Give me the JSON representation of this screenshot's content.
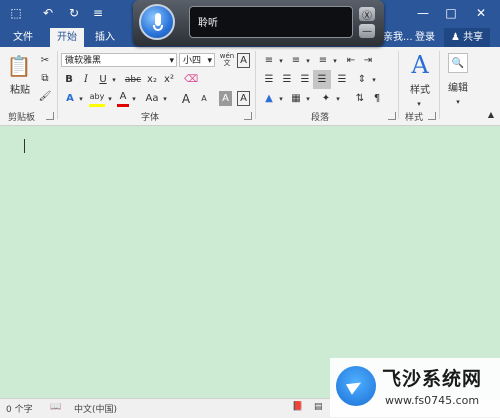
{
  "quick_access": {
    "save": "⬚",
    "undo": "↶",
    "redo": "↻",
    "more": "≡"
  },
  "window_controls": {
    "minimize": "—",
    "maximize": "□",
    "close": "✕"
  },
  "tabs": [
    {
      "label": "文件"
    },
    {
      "label": "开始"
    },
    {
      "label": "插入"
    },
    {
      "label": "亲我..."
    }
  ],
  "account": {
    "login": "登录",
    "share": "共享"
  },
  "voice_panel": {
    "text": "聆听",
    "close_glyph": "Ⓧ",
    "minimize_glyph": "—"
  },
  "clipboard": {
    "paste_label": "粘贴",
    "group_label": "剪贴板"
  },
  "font": {
    "name": "微软雅黑",
    "size": "小四",
    "bold": "B",
    "italic": "I",
    "underline": "U",
    "strike": "abc",
    "subscript": "x₂",
    "superscript": "x²",
    "font_color": "A",
    "highlight": "aby",
    "change_case": "Aa",
    "grow": "A",
    "shrink": "A",
    "char_border": "A",
    "char_shade": "A",
    "wen": "wén",
    "group_label": "字体"
  },
  "paragraph": {
    "group_label": "段落"
  },
  "styles": {
    "label": "样式",
    "group_label": "样式"
  },
  "editing": {
    "label": "编辑"
  },
  "status": {
    "word_count": "0 个字",
    "language": "中文(中国)"
  },
  "watermark": {
    "title": "飞沙系统网",
    "url": "www.fs0745.com"
  },
  "colors": {
    "accent": "#2b579a",
    "document": "#cdebd2",
    "font_color_bar": "#e00000",
    "highlight_bar": "#ffff00"
  }
}
